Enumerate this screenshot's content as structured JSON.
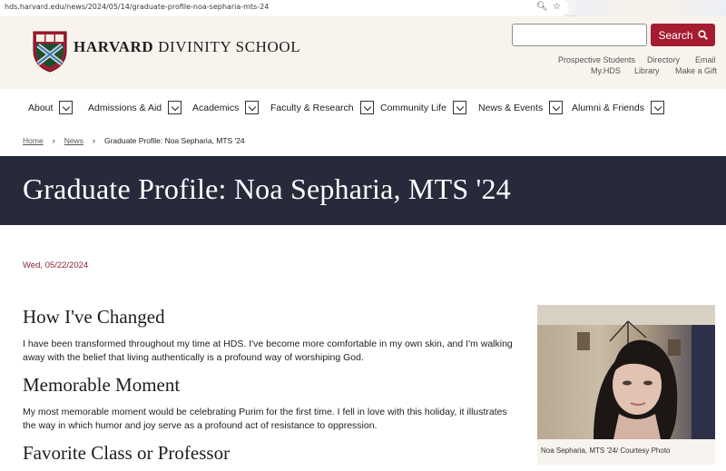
{
  "browser": {
    "url": "hds.harvard.edu/news/2024/05/14/graduate-profile-noa-sepharia-mts-24",
    "zoom_icon": "zoom-icon",
    "star_icon": "star-icon"
  },
  "header": {
    "logo_bold": "HARVARD",
    "logo_rest": " DIVINITY SCHOOL",
    "search_placeholder": "",
    "search_label": "Search",
    "links": {
      "prospective": "Prospective Students",
      "directory": "Directory",
      "email": "Email",
      "myhds": "My.HDS",
      "library": "Library",
      "gift": "Make a Gift"
    }
  },
  "nav": {
    "items": [
      "About",
      "Admissions & Aid",
      "Academics",
      "Faculty & Research",
      "Community Life",
      "News & Events",
      "Alumni & Friends"
    ]
  },
  "breadcrumb": {
    "home": "Home",
    "news": "News",
    "current": "Graduate Profile: Noa Sepharia, MTS '24"
  },
  "article": {
    "title": "Graduate Profile: Noa Sepharia, MTS '24",
    "date": "Wed, 05/22/2024",
    "sections": [
      {
        "heading": "How I've Changed",
        "text": "I have been transformed throughout my time at HDS. I've become more comfortable in my own skin, and I'm walking away with the belief that living authentically is a profound way of worshiping God."
      },
      {
        "heading": "Memorable Moment",
        "text": "My most memorable moment would be celebrating Purim for the first time. I fell in love with this holiday, it illustrates the way in which humor and joy serve as a profound act of resistance to oppression."
      },
      {
        "heading": "Favorite Class or Professor",
        "text": ""
      }
    ],
    "photo_caption": "Noa Sepharia, MTS '24/ Courtesy Photo"
  },
  "colors": {
    "crimson": "#a51c30",
    "band": "#262a3b",
    "header_bg": "#f8f3ed",
    "date": "#8b2332"
  }
}
